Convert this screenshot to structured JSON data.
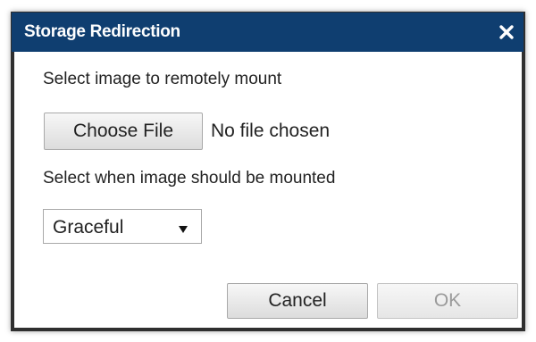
{
  "dialog": {
    "title": "Storage Redirection",
    "close_icon": "close-x-icon",
    "colors": {
      "titlebar": "#0f3e70",
      "frame": "#2f2f2f"
    }
  },
  "image_section": {
    "label": "Select image to remotely mount",
    "choose_file_label": "Choose File",
    "file_status": "No file chosen"
  },
  "mount_section": {
    "label": "Select when image should be mounted",
    "selected_option": "Graceful",
    "arrow_icon": "dropdown-triangle-icon"
  },
  "actions": {
    "cancel_label": "Cancel",
    "ok_label": "OK",
    "ok_disabled": true
  }
}
